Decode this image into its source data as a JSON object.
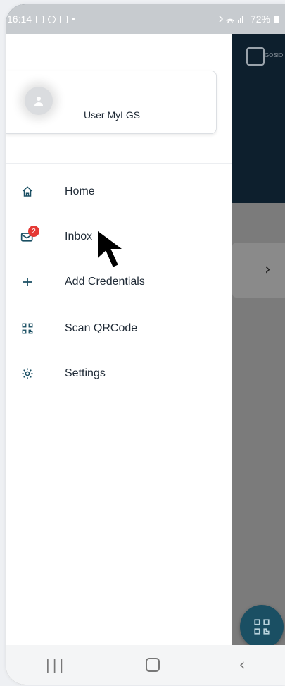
{
  "status_bar": {
    "time": "16:14",
    "battery": "72%"
  },
  "profile": {
    "name": "User MyLGS"
  },
  "menu": [
    {
      "label": "Home",
      "icon": "home-icon"
    },
    {
      "label": "Inbox",
      "icon": "mail-icon",
      "badge": "2"
    },
    {
      "label": "Add Credentials",
      "icon": "plus-icon"
    },
    {
      "label": "Scan QRCode",
      "icon": "qr-code-icon"
    },
    {
      "label": "Settings",
      "icon": "gear-icon"
    }
  ],
  "background_app": {
    "logo_text": "GOSIO"
  },
  "colors": {
    "accent": "#1a4f63",
    "badge": "#e53935",
    "dark_header": "#0d1f2d"
  }
}
